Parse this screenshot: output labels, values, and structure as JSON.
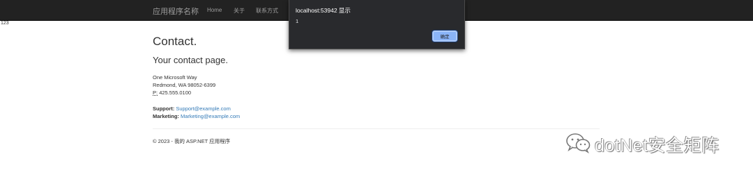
{
  "navbar": {
    "brand": "应用程序名称",
    "items": [
      "Home",
      "关于",
      "联系方式"
    ]
  },
  "stray_text": "123",
  "page": {
    "title": "Contact.",
    "subtitle": "Your contact page.",
    "address": {
      "line1": "One Microsoft Way",
      "line2": "Redmond, WA 98052-6399",
      "phone_label": "P:",
      "phone": "425.555.0100"
    },
    "support_label": "Support:",
    "support_email": "Support@example.com",
    "marketing_label": "Marketing:",
    "marketing_email": "Marketing@example.com"
  },
  "footer": "© 2023 - 我的 ASP.NET 应用程序",
  "dialog": {
    "title": "localhost:53942 显示",
    "message": "1",
    "ok_label": "确定"
  },
  "watermark": {
    "text": "dotNet安全矩阵",
    "icon": "wechat-icon"
  }
}
